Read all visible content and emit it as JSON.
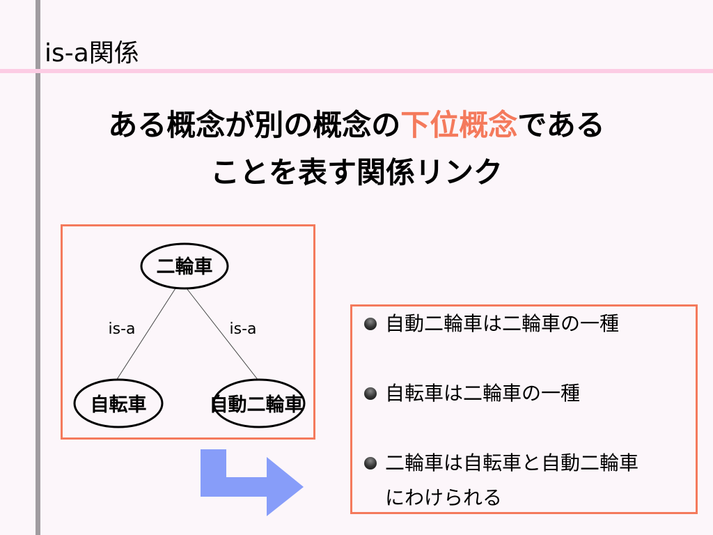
{
  "slide_title": "is-a関係",
  "heading": {
    "line1_pre": "ある概念が別の概念の",
    "line1_accent": "下位概念",
    "line1_post": "である",
    "line2": "ことを表す関係リンク"
  },
  "diagram": {
    "nodes": {
      "parent": "二輪車",
      "left": "自転車",
      "right": "自動二輪車"
    },
    "edge_labels": {
      "left": "is-a",
      "right": "is-a"
    }
  },
  "bullets": [
    {
      "text": "自動二輪車は二輪車の一種"
    },
    {
      "text": "自転車は二輪車の一種"
    },
    {
      "line1": "二輪車は自転車と自動二輪車",
      "line2": "にわけられる"
    }
  ],
  "colors": {
    "accent": "#f47a5c",
    "arrow": "#879df9",
    "rule": "#fccce4",
    "sidebar": "#a09ca0"
  }
}
